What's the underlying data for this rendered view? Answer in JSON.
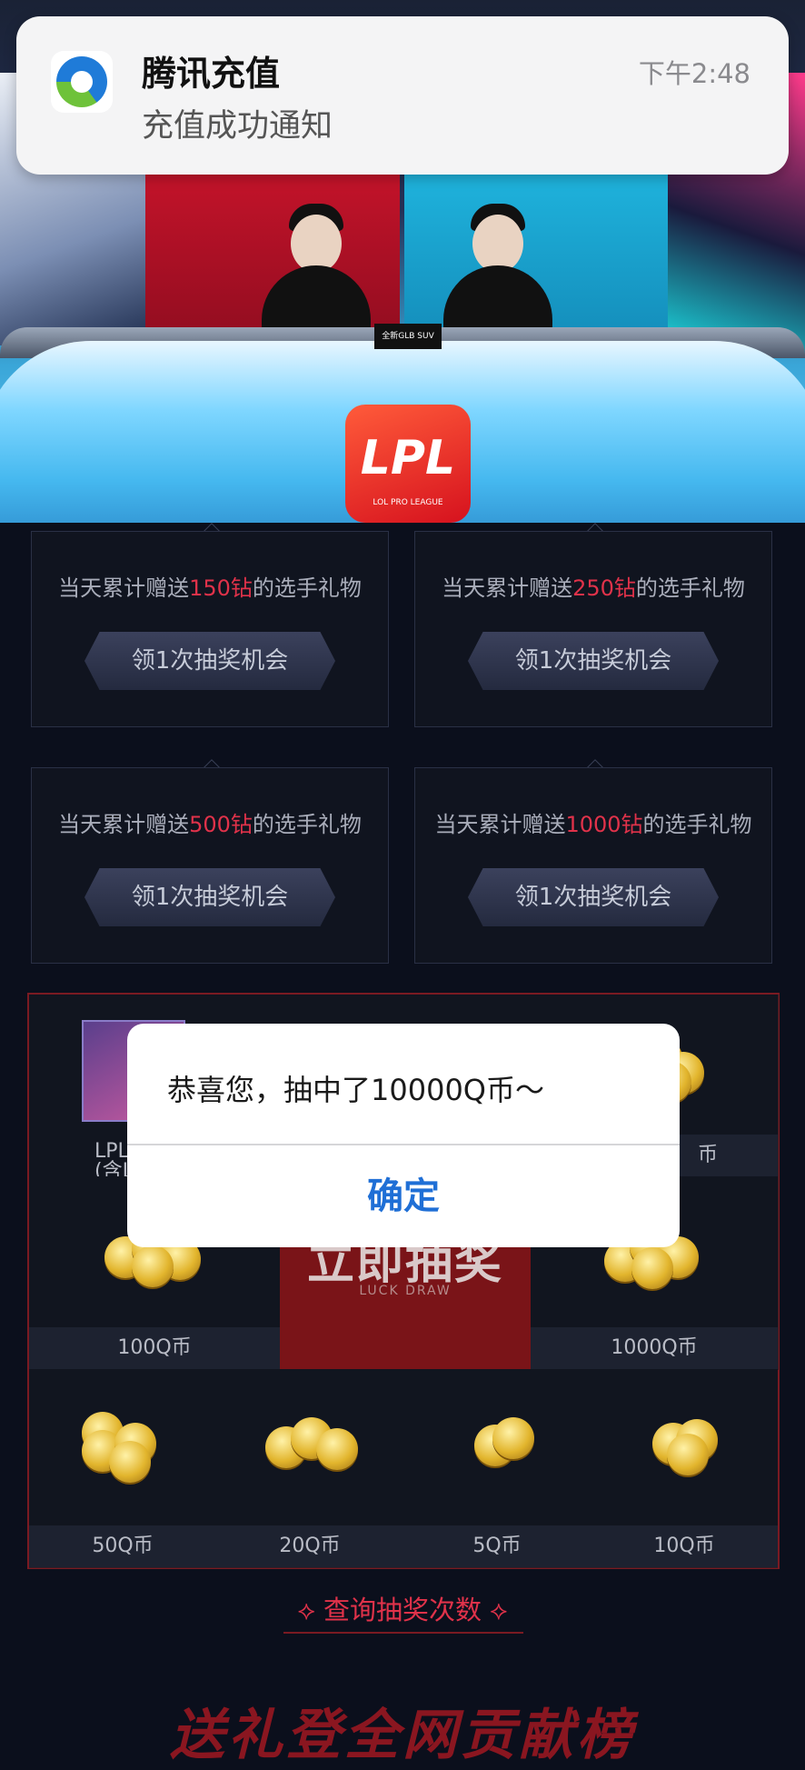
{
  "notification": {
    "app_name": "腾讯充值",
    "message": "充值成功通知",
    "time": "下午2:48"
  },
  "broadcast": {
    "logo_text": "LPL",
    "logo_sub": "LOL PRO LEAGUE",
    "desk_sign": "全新GLB SUV"
  },
  "tasks": [
    {
      "prefix": "当天累计赠送",
      "amount": "150钻",
      "suffix": "的选手礼物",
      "button": "领1次抽奖机会"
    },
    {
      "prefix": "当天累计赠送",
      "amount": "250钻",
      "suffix": "的选手礼物",
      "button": "领1次抽奖机会"
    },
    {
      "prefix": "当天累计赠送",
      "amount": "500钻",
      "suffix": "的选手礼物",
      "button": "领1次抽奖机会"
    },
    {
      "prefix": "当天累计赠送",
      "amount": "1000钻",
      "suffix": "的选手礼物",
      "button": "领1次抽奖机会"
    }
  ],
  "prizes": {
    "top_left": "LPL",
    "top_left_sub": "(含LPL",
    "top_right": "币",
    "mid_left": "100Q币",
    "mid_right": "1000Q币",
    "bottom": [
      "50Q币",
      "20Q币",
      "5Q币",
      "10Q币"
    ]
  },
  "draw_button": {
    "label": "立即抽奖",
    "sub": "LUCK DRAW"
  },
  "query_link": "查询抽奖次数",
  "banner": "送礼登全网贡献榜",
  "dialog": {
    "message": "恭喜您，抽中了10000Q币～",
    "confirm": "确定"
  },
  "colors": {
    "highlight": "#e0324a",
    "dialog_button": "#1f6fd6",
    "background": "#0b0f1c"
  }
}
